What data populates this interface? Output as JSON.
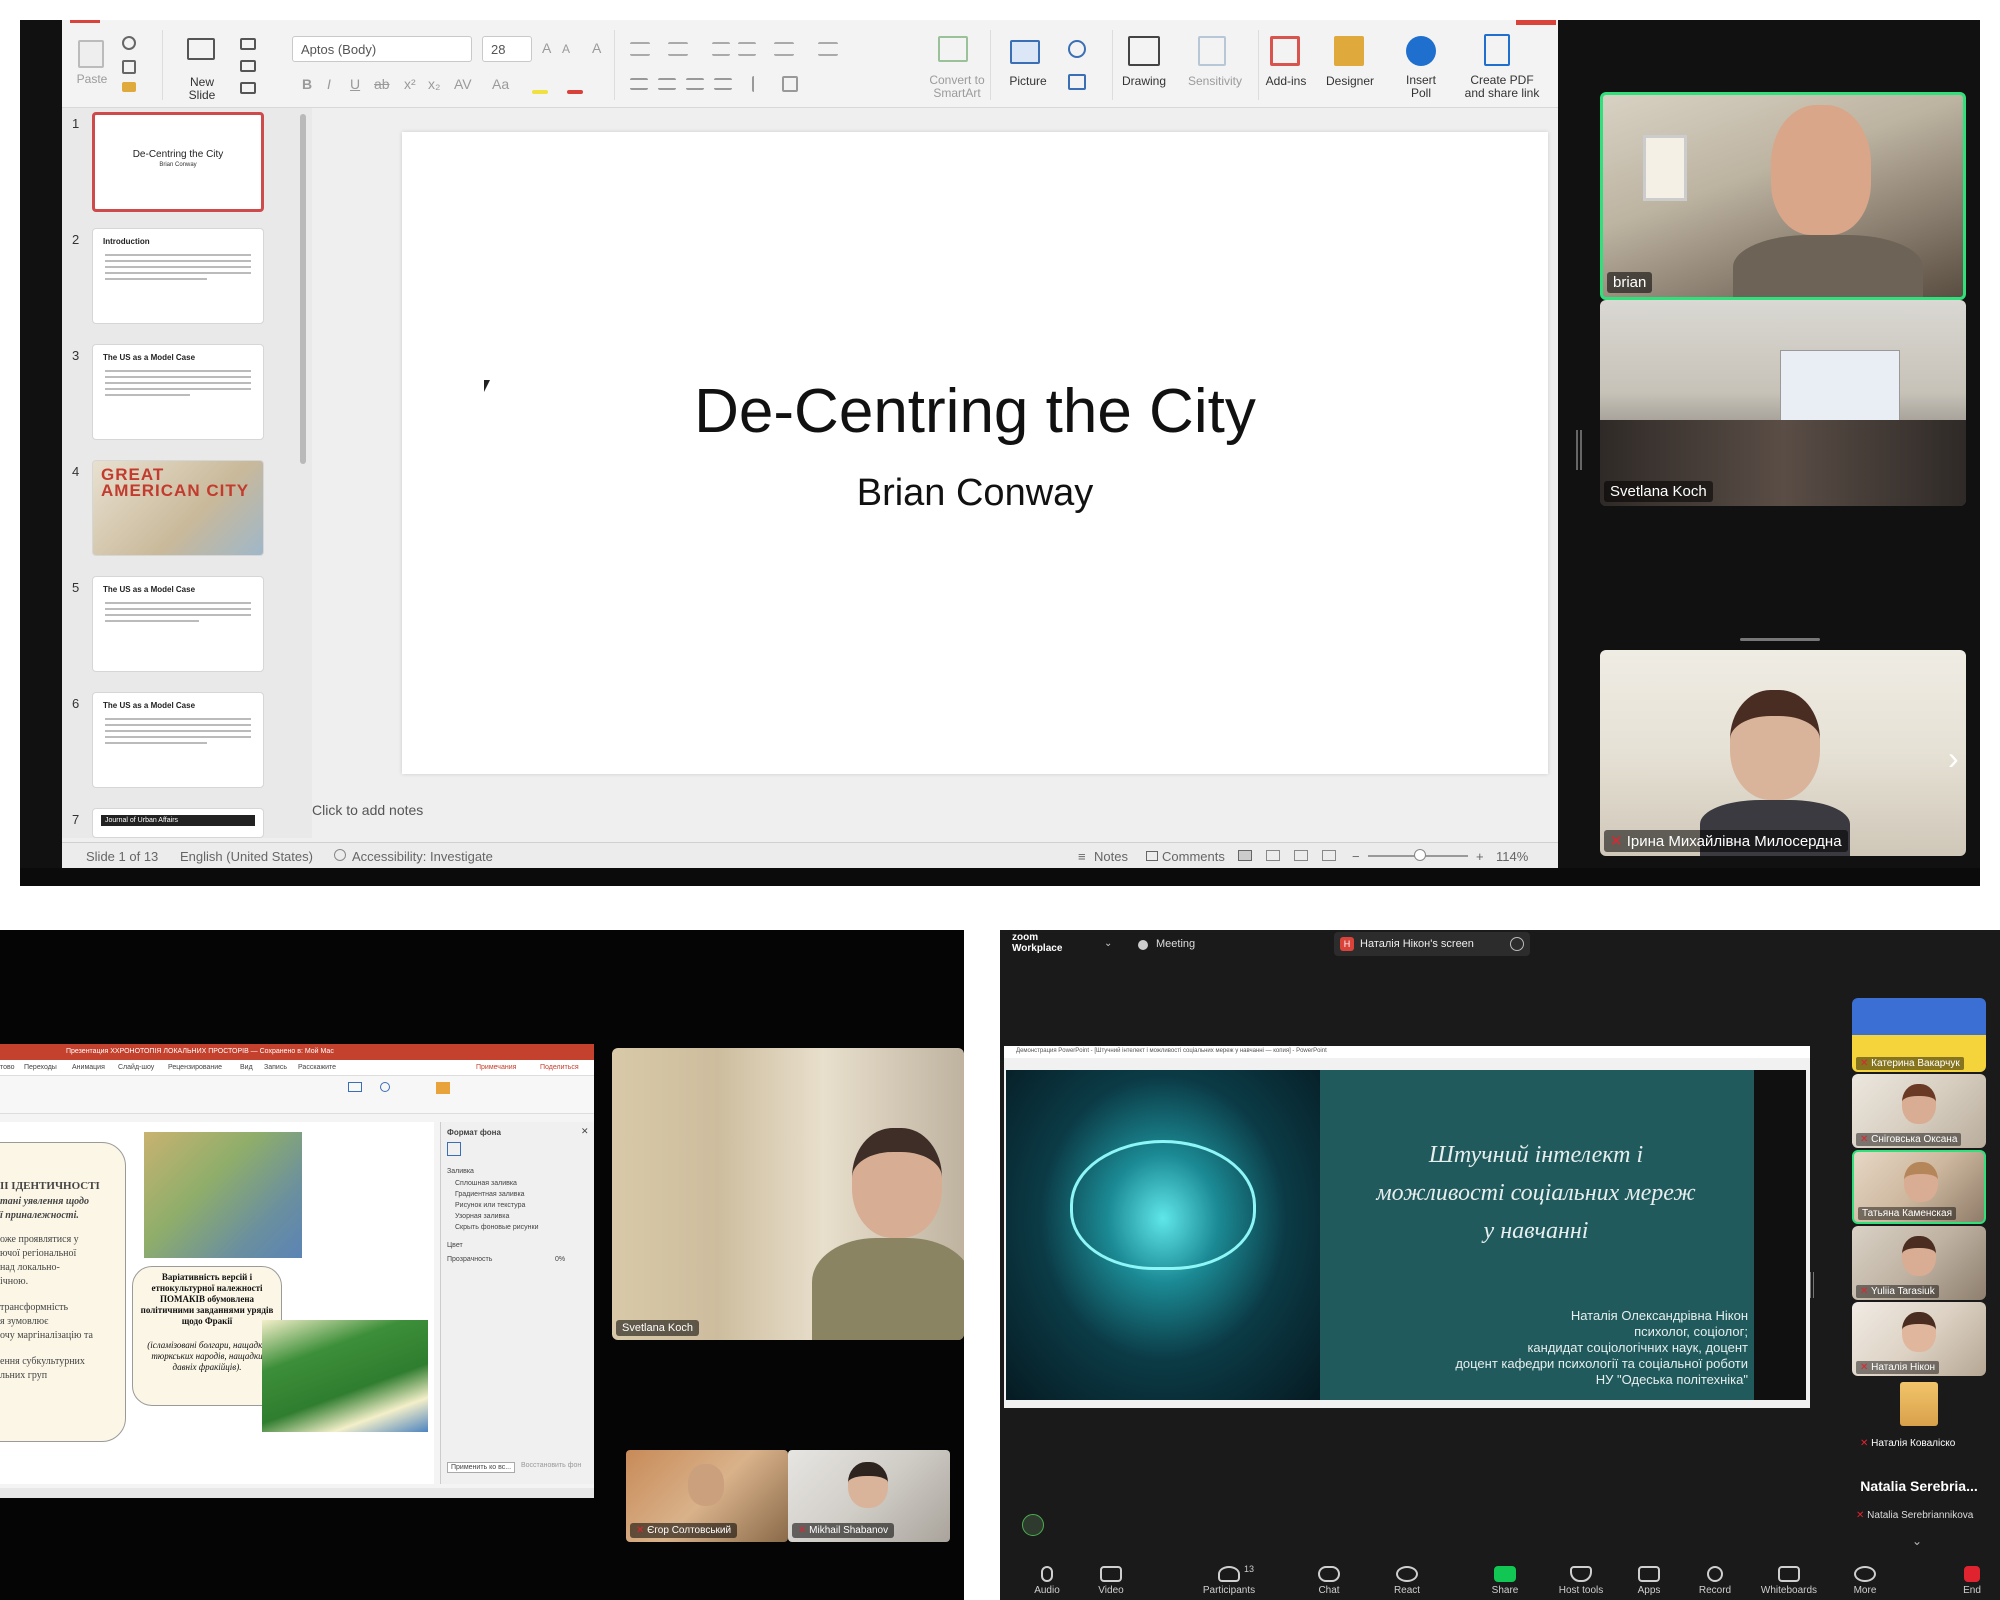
{
  "panel1": {
    "ribbon": {
      "paste": "Paste",
      "new_slide": "New\nSlide",
      "font_name": "Aptos (Body)",
      "font_size": "28",
      "convert_smartart": "Convert to\nSmartArt",
      "picture": "Picture",
      "drawing": "Drawing",
      "sensitivity": "Sensitivity",
      "addins": "Add-ins",
      "designer": "Designer",
      "insert_poll": "Insert\nPoll",
      "create_pdf": "Create PDF\nand share link"
    },
    "thumbnails": [
      {
        "num": "1",
        "title": "De-Centring the City",
        "subtitle": "Brian Conway"
      },
      {
        "num": "2",
        "title": "Introduction"
      },
      {
        "num": "3",
        "title": "The US as a Model Case"
      },
      {
        "num": "4",
        "title": "GREAT AMERICAN CITY"
      },
      {
        "num": "5",
        "title": "The US as a Model Case"
      },
      {
        "num": "6",
        "title": "The US as a Model Case"
      },
      {
        "num": "7",
        "title": "Journal of Urban Affairs"
      }
    ],
    "slide": {
      "title": "De-Centring the City",
      "subtitle": "Brian Conway"
    },
    "notes_placeholder": "Click to add notes",
    "status": {
      "slide_count": "Slide 1 of 13",
      "language": "English (United States)",
      "accessibility": "Accessibility: Investigate",
      "notes": "Notes",
      "comments": "Comments",
      "zoom": "114%"
    },
    "participants": [
      {
        "name": "brian"
      },
      {
        "name": "Svetlana Koch"
      },
      {
        "name": "Ірина Михайлівна Милосердна"
      }
    ]
  },
  "panel2": {
    "window_title": "Презентация ХХРОНОТОПІЯ ЛОКАЛЬНИХ ПРОСТОРІВ — Сохранено в: Мой Мас",
    "menu": [
      "тово",
      "Переходы",
      "Анимация",
      "Слайд-шоу",
      "Рецензирование",
      "Вид",
      "Запись",
      "Расскажите"
    ],
    "comments_btn": "Примечания",
    "share_btn": "Поделиться",
    "format_pane": {
      "title": "Формат фона",
      "section": "Заливка",
      "options": [
        "Сплошная заливка",
        "Градиентная заливка",
        "Рисунок или текстура",
        "Узорная заливка",
        "Скрыть фоновые рисунки"
      ],
      "color_label": "Цвет",
      "transparency_label": "Прозрачность",
      "transparency_value": "0%",
      "apply_all": "Применить ко вс...",
      "reset": "Восстановить фон"
    },
    "slide_left_lines": [
      "ІІ ІДЕНТИЧНОСТІ",
      "тані уявлення щодо",
      "ї приналежності.",
      "оже проявлятися у",
      "ючої регіональної",
      "над локально-",
      "ічною.",
      "трансформність",
      "я зумовлює",
      "очу маргіналізацію та",
      "ення субкультурних",
      "льних груп"
    ],
    "slide_bubble_title": "Варіативність версій і етнокультурної належності ПОМАКІВ обумовлена політичними завданнями урядів щодо Фракії",
    "slide_bubble_italic": "(ісламізовані болгари, нащадки тюркських народів, нащадки давніх фракійців).",
    "participants": [
      {
        "name": "Svetlana Koch"
      },
      {
        "name": "Єгор Солтовський"
      },
      {
        "name": "Mikhail Shabanov"
      }
    ]
  },
  "panel3": {
    "app": "zoom\nWorkplace",
    "meeting": "Meeting",
    "share_banner": "Наталія Нікон's screen",
    "window_title": "Демонстрация PowerPoint - [Штучний інтелект і можливості соціальних мереж у навчанні — копия] - PowerPoint",
    "slide_title_lines": [
      "Штучний інтелект і",
      "можливості соціальних мереж",
      "у навчанні"
    ],
    "author_lines": [
      "Наталія Олександрівна Нікон",
      "психолог, соціолог;",
      "кандидат соціологічних наук, доцент",
      "доцент кафедри психології та соціальної роботи",
      "НУ \"Одеська політехніка\""
    ],
    "participants": [
      {
        "name": "Катерина Вакарчук"
      },
      {
        "name": "Сніговська Оксана"
      },
      {
        "name": "Татьяна Каменская"
      },
      {
        "name": "Yuliia Tarasiuk"
      },
      {
        "name": "Наталія Нікон"
      },
      {
        "name": "Наталія Коваліско"
      }
    ],
    "big_name": "Natalia Serebria...",
    "big_name_sub": "Natalia Serebriannikova",
    "toolbar": [
      {
        "label": "Audio"
      },
      {
        "label": "Video"
      },
      {
        "label": "Participants",
        "count": "13"
      },
      {
        "label": "Chat"
      },
      {
        "label": "React"
      },
      {
        "label": "Share"
      },
      {
        "label": "Host tools"
      },
      {
        "label": "Apps"
      },
      {
        "label": "Record"
      },
      {
        "label": "Whiteboards"
      },
      {
        "label": "More"
      },
      {
        "label": "End"
      }
    ],
    "colors": {
      "share": "#12c653",
      "end": "#e0242f",
      "banner_h": "#d9433a",
      "active": "#2fe07b"
    }
  }
}
